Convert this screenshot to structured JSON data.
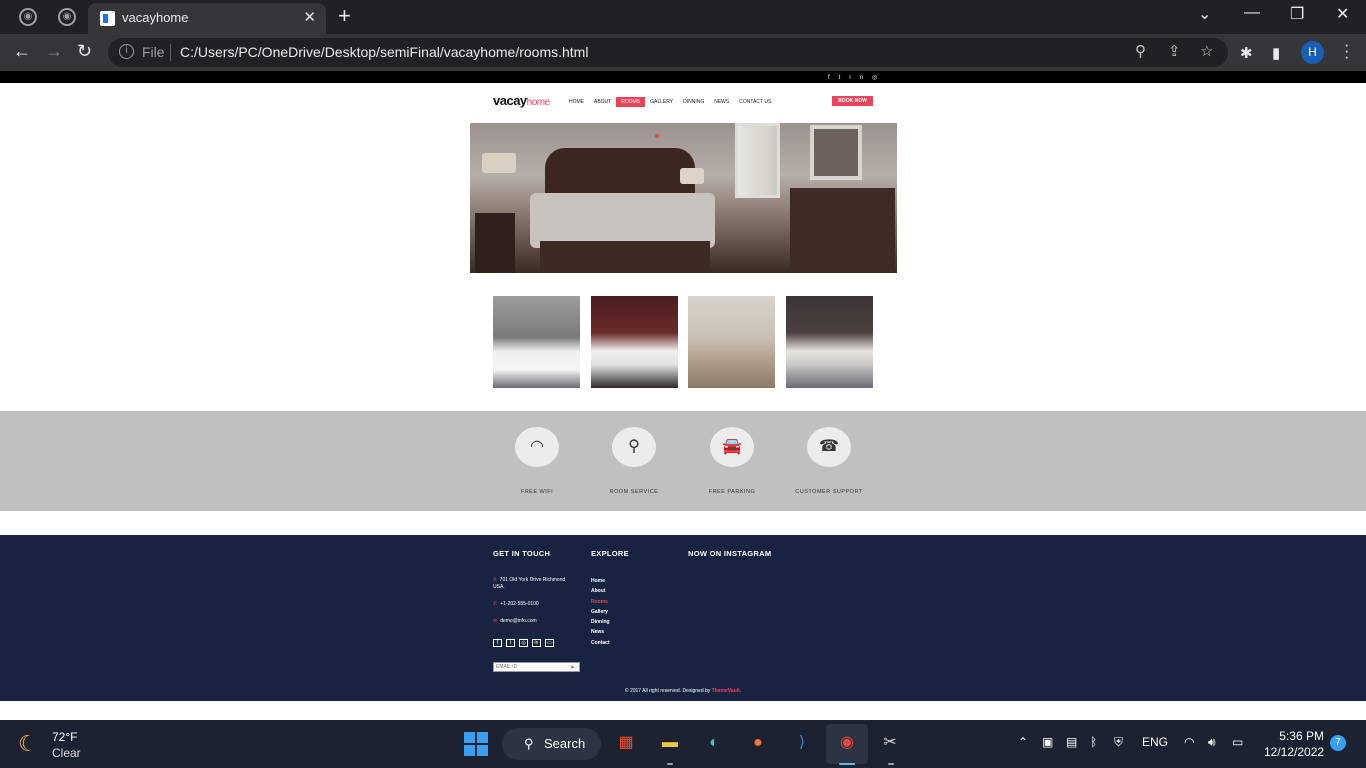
{
  "browser": {
    "tab_title": "vacayhome",
    "protocol_label": "File",
    "url": "C:/Users/PC/OneDrive/Desktop/semiFinal/vacayhome/rooms.html",
    "profile_initial": "H",
    "new_tab_symbol": "+",
    "close_symbol": "✕"
  },
  "site": {
    "logo_main": "vacay",
    "logo_accent": "home",
    "social_top": [
      "f",
      "t",
      "in",
      "◎"
    ],
    "nav": [
      {
        "label": "HOME",
        "active": false
      },
      {
        "label": "ABOUT",
        "active": false
      },
      {
        "label": "ROOMS",
        "active": true
      },
      {
        "label": "GALLERY",
        "active": false
      },
      {
        "label": "DINNING",
        "active": false
      },
      {
        "label": "NEWS",
        "active": false
      },
      {
        "label": "CONTACT US",
        "active": false
      }
    ],
    "book_now": "BOOK NOW",
    "features": [
      {
        "label": "FREE WIFI",
        "icon": "wifi-icon",
        "glyph": "◠"
      },
      {
        "label": "ROOM SERVICE",
        "icon": "room-service-icon",
        "glyph": "⚲"
      },
      {
        "label": "FREE PARKING",
        "icon": "parking-icon",
        "glyph": "🚘"
      },
      {
        "label": "CUSTOMER SUPPORT",
        "icon": "support-icon",
        "glyph": "☎"
      }
    ],
    "footer": {
      "get_in_touch": "GET IN TOUCH",
      "explore": "EXPLORE",
      "instagram": "NOW ON INSTAGRAM",
      "address": "701 Old York Drive Richmond USA.",
      "phone": "+1-202-555-0100",
      "email": "demo@info.com",
      "explore_links": [
        {
          "label": "Home",
          "active": false
        },
        {
          "label": "About",
          "active": false
        },
        {
          "label": "Rooms",
          "active": true
        },
        {
          "label": "Gallery",
          "active": false
        },
        {
          "label": "Dinning",
          "active": false
        },
        {
          "label": "News",
          "active": false
        },
        {
          "label": "Contact",
          "active": false
        }
      ],
      "email_placeholder": "EMAIL ID",
      "copyright": "© 2017 All right reserved. Designed by ",
      "designer": "ThemeVault."
    }
  },
  "taskbar": {
    "temperature": "72°F",
    "condition": "Clear",
    "search_label": "Search",
    "language": "ENG",
    "time": "5:36 PM",
    "date": "12/12/2022",
    "notification_count": "7"
  },
  "colors": {
    "accent": "#e8445a",
    "footer_bg": "#172341",
    "features_bg": "#c0c0c0"
  }
}
